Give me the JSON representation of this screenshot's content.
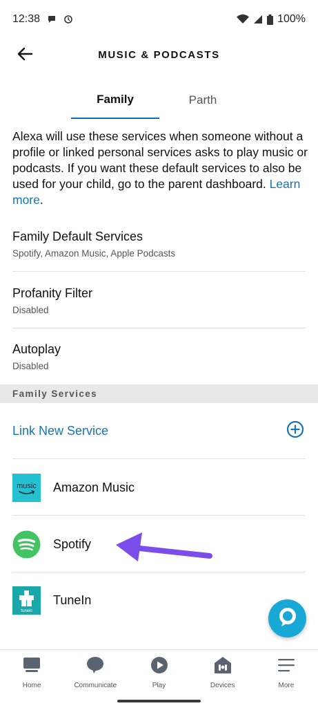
{
  "status_bar": {
    "time": "12:38",
    "battery": "100%",
    "icons": [
      "chat-bubble-icon",
      "data-saver-icon",
      "wifi-icon",
      "signal-icon",
      "battery-icon"
    ]
  },
  "header": {
    "title": "MUSIC & PODCASTS",
    "back_icon": "arrow-left-icon"
  },
  "tabs": [
    {
      "label": "Family",
      "active": true
    },
    {
      "label": "Parth",
      "active": false
    }
  ],
  "intro": {
    "text": "Alexa will use these services when someone without a profile or linked personal services asks to play music or podcasts. If you want these default services to also be used for your child, go to the parent dashboard.",
    "link": "Learn more",
    "suffix": "."
  },
  "settings": [
    {
      "title": "Family Default Services",
      "subtitle": "Spotify, Amazon Music, Apple Podcasts"
    },
    {
      "title": "Profanity Filter",
      "subtitle": "Disabled"
    },
    {
      "title": "Autoplay",
      "subtitle": "Disabled"
    }
  ],
  "section": {
    "title": "Family Services"
  },
  "link_service": {
    "label": "Link New Service",
    "icon": "plus-circle-icon"
  },
  "services": [
    {
      "name": "Amazon Music",
      "icon": "amazon-music-logo",
      "logo_text": "music"
    },
    {
      "name": "Spotify",
      "icon": "spotify-logo"
    },
    {
      "name": "TuneIn",
      "icon": "tunein-logo",
      "logo_text": "tunein"
    }
  ],
  "bottom_nav": [
    {
      "label": "Home",
      "icon": "home-icon"
    },
    {
      "label": "Communicate",
      "icon": "speech-bubble-icon"
    },
    {
      "label": "Play",
      "icon": "play-icon"
    },
    {
      "label": "Devices",
      "icon": "devices-icon"
    },
    {
      "label": "More",
      "icon": "menu-icon"
    }
  ],
  "colors": {
    "accent": "#1673b9",
    "tab_underline": "#0a6fb5",
    "alexa": "#17a8d6",
    "annotation_arrow": "#7b4dea",
    "spotify": "#43c463",
    "amazon_music": "#24c2d0",
    "tunein": "#1aa7a7"
  }
}
